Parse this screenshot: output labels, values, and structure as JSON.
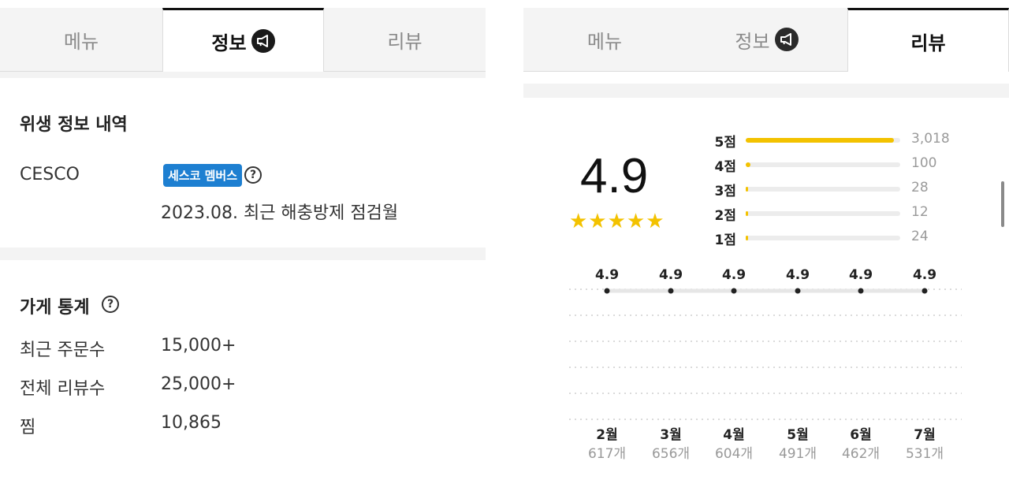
{
  "left_panel": {
    "tabs": [
      {
        "label": "메뉴",
        "active": false
      },
      {
        "label": "정보",
        "active": true,
        "icon": "megaphone-icon"
      },
      {
        "label": "리뷰",
        "active": false
      }
    ],
    "hygiene": {
      "title": "위생 정보 내역",
      "company": "CESCO",
      "badge": "세스코 멤버스",
      "help_icon": "?",
      "inspection": "2023.08. 최근 해충방제 점검월"
    },
    "stats": {
      "title": "가게 통계",
      "help_icon": "?",
      "rows": [
        {
          "label": "최근 주문수",
          "value": "15,000+"
        },
        {
          "label": "전체 리뷰수",
          "value": "25,000+"
        },
        {
          "label": "찜",
          "value": "10,865"
        }
      ]
    }
  },
  "right_panel": {
    "tabs": [
      {
        "label": "메뉴",
        "active": false
      },
      {
        "label": "정보",
        "active": false,
        "icon": "megaphone-icon"
      },
      {
        "label": "리뷰",
        "active": true
      }
    ],
    "rating": {
      "score": "4.9",
      "stars": "★★★★★",
      "star_color": "#f3c200",
      "distribution": [
        {
          "label": "5점",
          "count": "3,018",
          "fraction": 0.96
        },
        {
          "label": "4점",
          "count": "100",
          "fraction": 0.03
        },
        {
          "label": "3점",
          "count": "28",
          "fraction": 0.01
        },
        {
          "label": "2점",
          "count": "12",
          "fraction": 0.0
        },
        {
          "label": "1점",
          "count": "24",
          "fraction": 0.01
        }
      ]
    },
    "trend": {
      "months": [
        {
          "label": "2월",
          "count": "617개",
          "score": "4.9"
        },
        {
          "label": "3월",
          "count": "656개",
          "score": "4.9"
        },
        {
          "label": "4월",
          "count": "604개",
          "score": "4.9"
        },
        {
          "label": "5월",
          "count": "491개",
          "score": "4.9"
        },
        {
          "label": "6월",
          "count": "462개",
          "score": "4.9"
        },
        {
          "label": "7월",
          "count": "531개",
          "score": "4.9"
        }
      ]
    }
  },
  "chart_data": {
    "type": "line",
    "categories": [
      "2월",
      "3월",
      "4월",
      "5월",
      "6월",
      "7월"
    ],
    "series": [
      {
        "values": [
          4.9,
          4.9,
          4.9,
          4.9,
          4.9,
          4.9
        ]
      }
    ],
    "grid": true,
    "legend": "none"
  },
  "colors": {
    "accent": "#f3c200",
    "badge": "#1d7fd1"
  }
}
